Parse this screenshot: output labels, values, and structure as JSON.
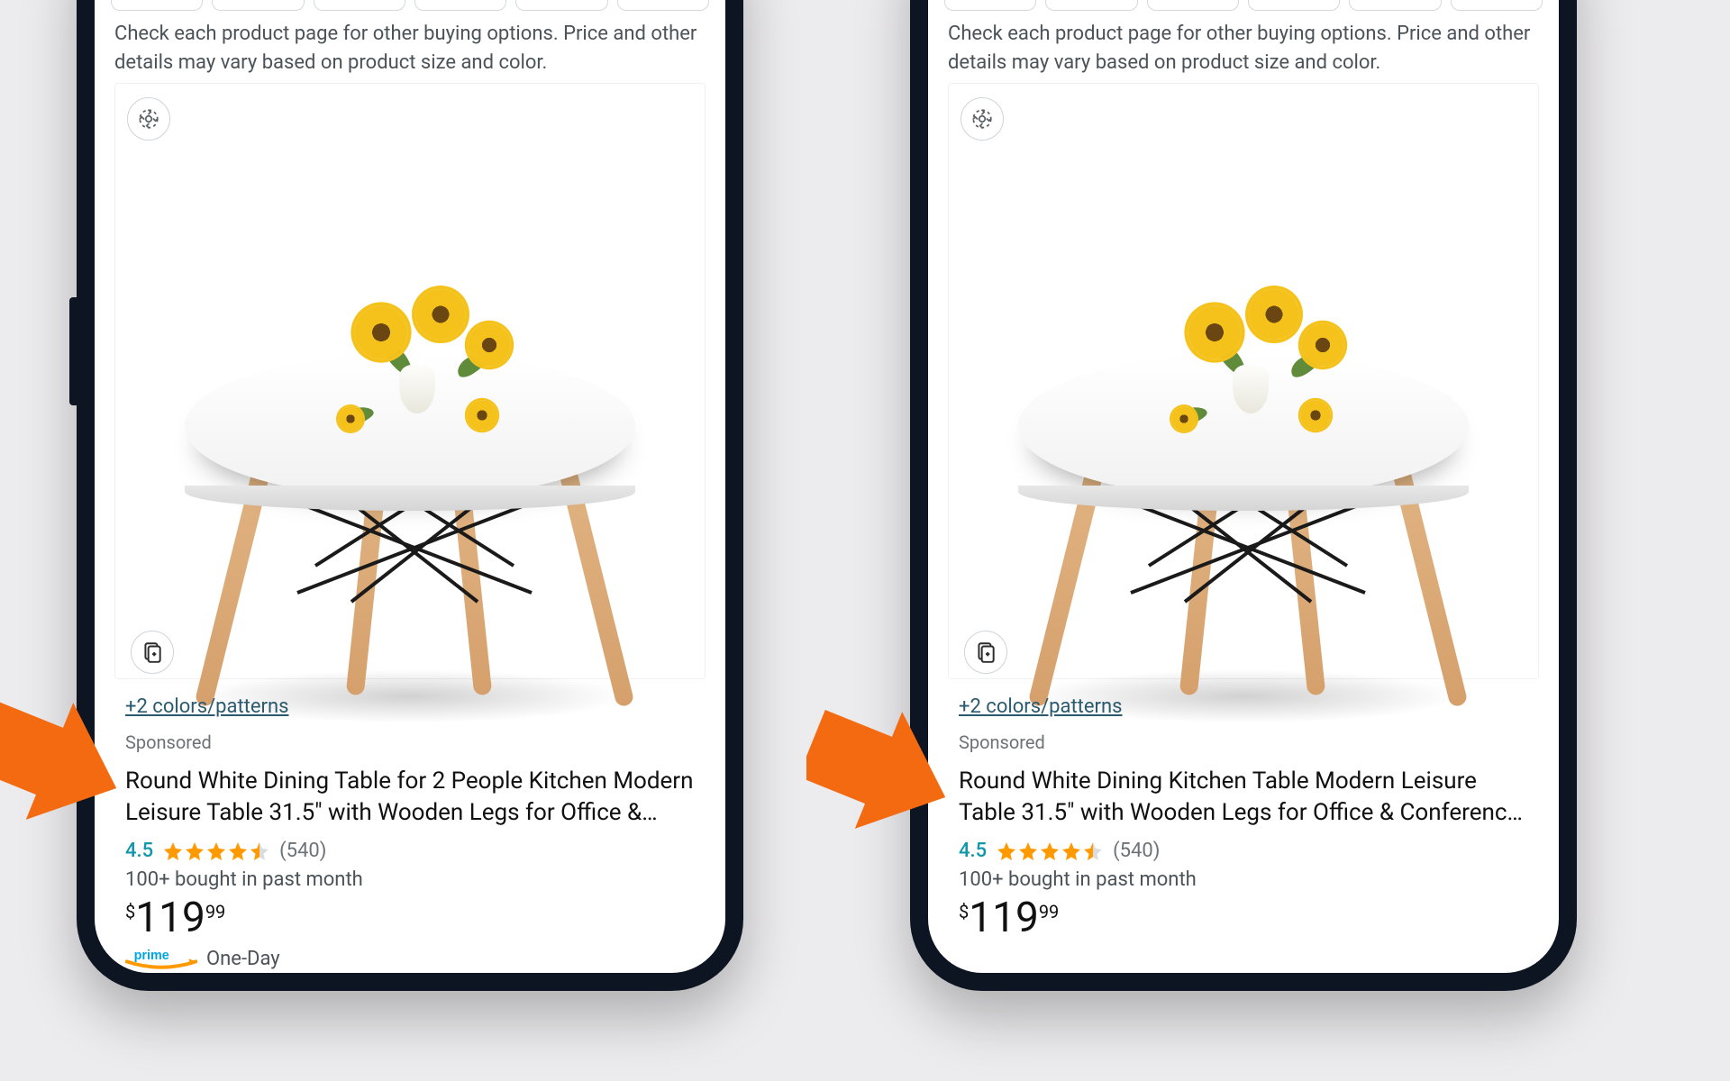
{
  "notice": "Check each product page for other buying options. Price and other details may vary based on product size and color.",
  "product_left": {
    "variants": "+2 colors/patterns",
    "sponsored": "Sponsored",
    "title": "Round White Dining Table for 2 People Kitchen Modern Leisure Table 31.5\" with Wooden Legs for Office &…",
    "rating": "4.5",
    "rating_count": "(540)",
    "bought": "100+ bought in past month",
    "price_symbol": "$",
    "price_whole": "119",
    "price_fraction": "99",
    "shipping": "One-Day"
  },
  "product_right": {
    "variants": "+2 colors/patterns",
    "sponsored": "Sponsored",
    "title": "Round White Dining Kitchen Table Modern Leisure Table 31.5\" with Wooden Legs for Office & Conferenc…",
    "rating": "4.5",
    "rating_count": "(540)",
    "bought": "100+ bought in past month",
    "price_symbol": "$",
    "price_whole": "119",
    "price_fraction": "99",
    "shipping": ""
  }
}
